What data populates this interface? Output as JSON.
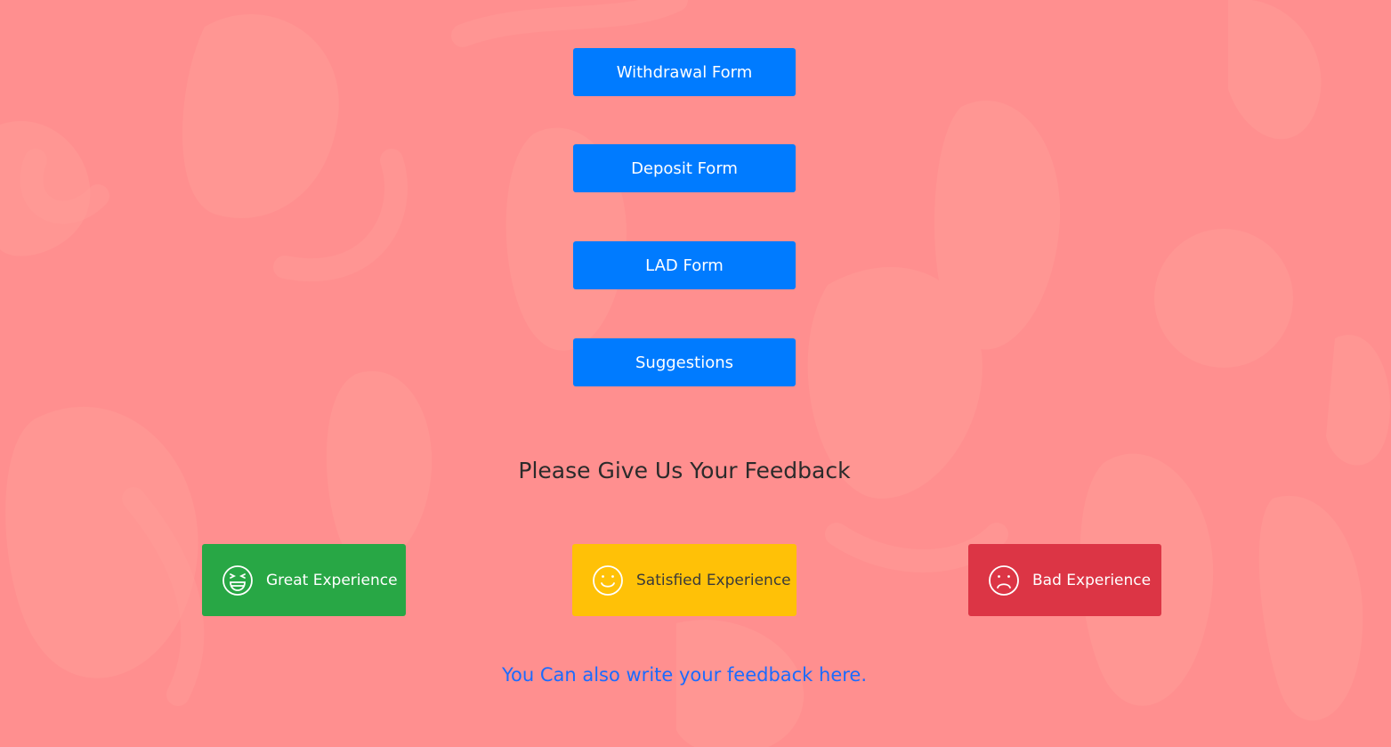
{
  "colors": {
    "background": "#ff8f8f",
    "primary": "#007bff",
    "success": "#28a745",
    "warning": "#ffc107",
    "danger": "#dc3545",
    "link": "#1a6bff",
    "heading": "#2b2b2b"
  },
  "nav": {
    "withdrawal_label": "Withdrawal Form",
    "deposit_label": "Deposit Form",
    "lad_label": "LAD Form",
    "suggestions_label": "Suggestions"
  },
  "feedback": {
    "heading": "Please Give Us Your Feedback",
    "great": {
      "label": "Great Experience",
      "icon": "laughing-face-icon"
    },
    "satisfied": {
      "label": "Satisfied Experience",
      "icon": "smiling-face-icon"
    },
    "bad": {
      "label": "Bad Experience",
      "icon": "frowning-face-icon"
    },
    "write_link": "You Can also write your feedback here."
  }
}
